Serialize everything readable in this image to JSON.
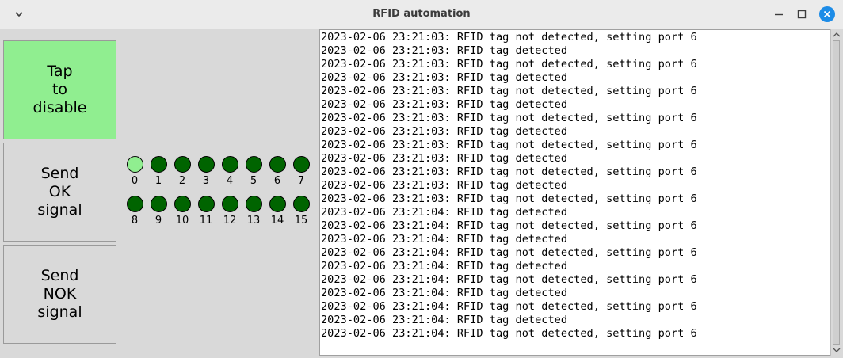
{
  "window": {
    "title": "RFID automation"
  },
  "buttons": {
    "toggle_label": "Tap\nto\ndisable",
    "ok_label": "Send\nOK\nsignal",
    "nok_label": "Send\nNOK\nsignal",
    "toggle_color": "#90ee90"
  },
  "ports": [
    {
      "label": "0",
      "state": "on"
    },
    {
      "label": "1",
      "state": "off"
    },
    {
      "label": "2",
      "state": "off"
    },
    {
      "label": "3",
      "state": "off"
    },
    {
      "label": "4",
      "state": "off"
    },
    {
      "label": "5",
      "state": "off"
    },
    {
      "label": "6",
      "state": "off"
    },
    {
      "label": "7",
      "state": "off"
    },
    {
      "label": "8",
      "state": "off"
    },
    {
      "label": "9",
      "state": "off"
    },
    {
      "label": "10",
      "state": "off"
    },
    {
      "label": "11",
      "state": "off"
    },
    {
      "label": "12",
      "state": "off"
    },
    {
      "label": "13",
      "state": "off"
    },
    {
      "label": "14",
      "state": "off"
    },
    {
      "label": "15",
      "state": "off"
    }
  ],
  "colors": {
    "led_on": "#90ee90",
    "led_off": "#006400",
    "close_button": "#1d8ce7"
  },
  "log": [
    "2023-02-06 23:21:03: RFID tag not detected, setting port 6",
    "2023-02-06 23:21:03: RFID tag detected",
    "2023-02-06 23:21:03: RFID tag not detected, setting port 6",
    "2023-02-06 23:21:03: RFID tag detected",
    "2023-02-06 23:21:03: RFID tag not detected, setting port 6",
    "2023-02-06 23:21:03: RFID tag detected",
    "2023-02-06 23:21:03: RFID tag not detected, setting port 6",
    "2023-02-06 23:21:03: RFID tag detected",
    "2023-02-06 23:21:03: RFID tag not detected, setting port 6",
    "2023-02-06 23:21:03: RFID tag detected",
    "2023-02-06 23:21:03: RFID tag not detected, setting port 6",
    "2023-02-06 23:21:03: RFID tag detected",
    "2023-02-06 23:21:03: RFID tag not detected, setting port 6",
    "2023-02-06 23:21:04: RFID tag detected",
    "2023-02-06 23:21:04: RFID tag not detected, setting port 6",
    "2023-02-06 23:21:04: RFID tag detected",
    "2023-02-06 23:21:04: RFID tag not detected, setting port 6",
    "2023-02-06 23:21:04: RFID tag detected",
    "2023-02-06 23:21:04: RFID tag not detected, setting port 6",
    "2023-02-06 23:21:04: RFID tag detected",
    "2023-02-06 23:21:04: RFID tag not detected, setting port 6",
    "2023-02-06 23:21:04: RFID tag detected",
    "2023-02-06 23:21:04: RFID tag not detected, setting port 6"
  ],
  "icons": {
    "menu": "chevron-down-icon",
    "minimize": "minimize-icon",
    "maximize": "maximize-icon",
    "close": "close-icon",
    "scroll_up": "arrow-up-icon",
    "scroll_down": "arrow-down-icon"
  }
}
